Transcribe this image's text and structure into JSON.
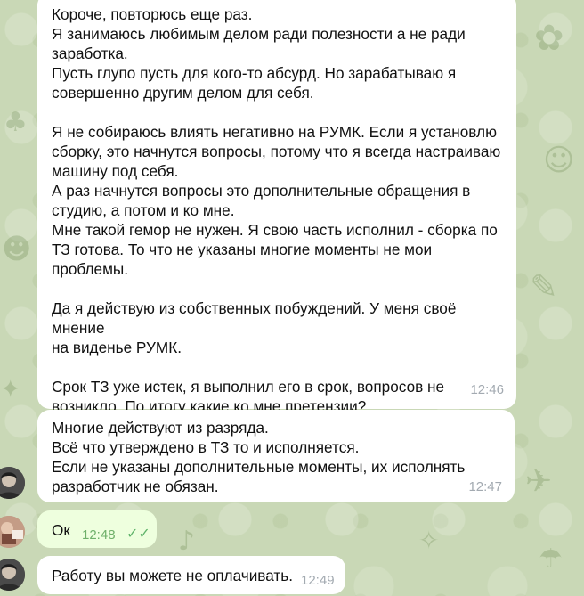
{
  "messages": [
    {
      "text": "Короче, повторюсь еще раз.\nЯ занимаюсь любимым делом ради полезности а не ради\nзаработка.\nПусть глупо пусть для кого-то абсурд. Но зарабатываю я\nсовершенно другим делом для себя.\n\nЯ не собираюсь влиять негативно на РУМК. Если я установлю\nсборку, это начнутся вопросы, потому что я всегда настраиваю\nмашину под себя.\nА раз начнутся вопросы это дополнительные обращения в\nстудию, а потом и ко мне.\nМне такой гемор не нужен. Я свою часть исполнил - сборка по\nТЗ готова. То что не указаны многие моменты не мои\nпроблемы.\n\nДа я действую из собственных побуждений. У меня своё мнение\nна виденье РУМК.\n\nСрок ТЗ уже истек, я выполнил его в срок, вопросов не\nвозникло. По итогу какие ко мне претензии?",
      "time": "12:46"
    },
    {
      "text": "Многие действуют из разряда.\nВсё что утверждено в ТЗ то и исполняется.\nЕсли не указаны дополнительные моменты, их исполнять\nразработчик не обязан.",
      "time": "12:47"
    },
    {
      "text": "Ок",
      "time": "12:48",
      "status_icon": "double-check-icon"
    },
    {
      "text": "Работу вы можете не оплачивать.",
      "time": "12:49"
    }
  ]
}
